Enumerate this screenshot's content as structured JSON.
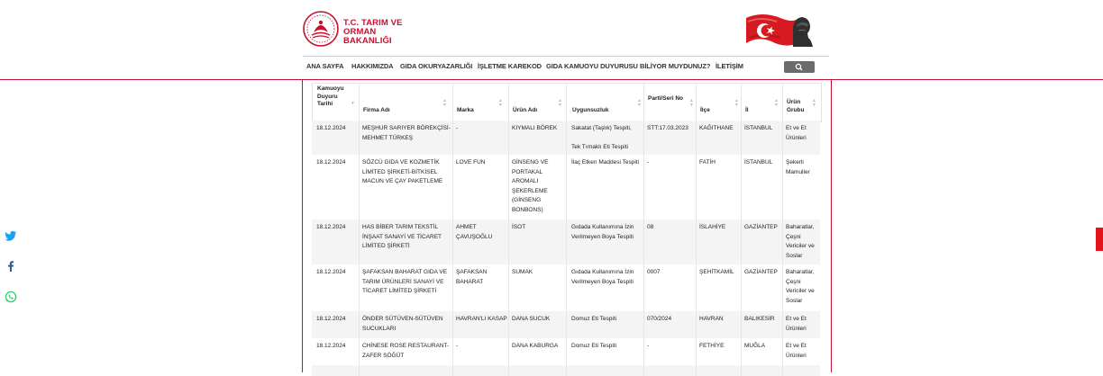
{
  "brand": {
    "line1": "T.C. TARIM VE",
    "line2": "ORMAN BAKANLIĞI"
  },
  "nav": {
    "items": [
      "ANA SAYFA",
      "HAKKIMIZDA",
      "GIDA OKURYAZARLIĞI",
      "İŞLETME KAREKOD",
      "GIDA KAMUOYU DUYURUSU",
      "BİLİYOR MUYDUNUZ?",
      "İLETİŞİM"
    ],
    "search_icon": "search-icon"
  },
  "social": [
    "twitter-icon",
    "facebook-icon",
    "whatsapp-icon"
  ],
  "colors": {
    "brand_red": "#c8102e",
    "accent_red": "#e3141b",
    "search_gray": "#6b6b6b"
  },
  "table": {
    "headers": [
      "Kamuoyu Duyuru Tarihi",
      "Firma Adı",
      "Marka",
      "Ürün Adı",
      "Uygunsuzluk",
      "Parti/Seri No",
      "İlçe",
      "İl",
      "Ürün Grubu"
    ],
    "rows": [
      [
        "18.12.2024",
        "MEŞHUR SARIYER BÖREKÇİSİ-MEHMET TÜRKEŞ",
        "-",
        "KIYMALI BÖREK",
        "Sakatat (Taşlık) Tespiti,\n\nTek Tırnaklı Eti Tespiti",
        "STT:17.03.2023",
        "KAĞITHANE",
        "İSTANBUL",
        "Et ve Et Ürünleri"
      ],
      [
        "18.12.2024",
        "SÖZCÜ GIDA VE KOZMETİK LİMİTED ŞİRKETİ-BİTKİSEL MACUN VE ÇAY PAKETLEME",
        "LOVE FUN",
        "GİNSENG VE PORTAKAL AROMALI ŞEKERLEME (GİNSENG BONBONS)",
        "İlaç Etken Maddesi Tespiti",
        "-",
        "FATİH",
        "İSTANBUL",
        "Şekerli Mamuller"
      ],
      [
        "18.12.2024",
        "HAS BİBER TARIM TEKSTİL İNŞAAT SANAYİ VE TİCARET LİMİTED ŞİRKETİ",
        "AHMET ÇAVUŞOĞLU",
        "İSOT",
        "Gıdada Kullanımına İzin Verilmeyen Boya Tespiti",
        "08",
        "İSLAHİYE",
        "GAZİANTEP",
        "Baharatlar, Çeşni Vericiler ve Soslar"
      ],
      [
        "18.12.2024",
        "ŞAFAKSAN BAHARAT GIDA VE TARIM ÜRÜNLERİ SANAYİ VE TİCARET LİMİTED ŞİRKETİ",
        "ŞAFAKSAN BAHARAT",
        "SUMAK",
        "Gıdada Kullanımına İzin Verilmeyen Boya Tespiti",
        "0007",
        "ŞEHİTKAMİL",
        "GAZİANTEP",
        "Baharatlar, Çeşni Vericiler ve Soslar"
      ],
      [
        "18.12.2024",
        "ÖNDER SÜTÜVEN-SÜTÜVEN SUCUKLARI",
        "HAVRAN'LI KASAP",
        "DANA SUCUK",
        "Domuz Eti Tespiti",
        "070/2024",
        "HAVRAN",
        "BALIKESİR",
        "Et ve Et Ürünleri"
      ],
      [
        "18.12.2024",
        "CHİNESE ROSE RESTAURANT-ZAFER SÖĞÜT",
        "-",
        "DANA KABURGA",
        "Domuz Eti Tespiti",
        "-",
        "FETHİYE",
        "MUĞLA",
        "Et ve Et Ürünleri"
      ]
    ]
  }
}
